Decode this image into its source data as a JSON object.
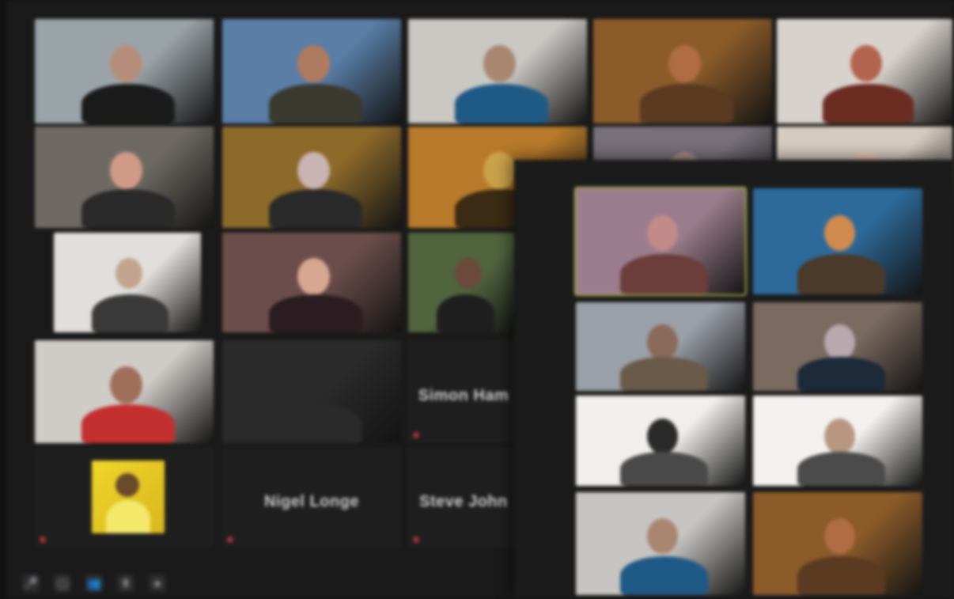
{
  "window": {
    "title": ""
  },
  "back_grid": {
    "tiles": [
      {
        "name": "",
        "bg": "#9aa3a8",
        "skin": "#b48e7a",
        "shirt": "#1b1b1b"
      },
      {
        "name": "",
        "bg": "#5a7ea6",
        "skin": "#b07a5e",
        "shirt": "#3a3a2e"
      },
      {
        "name": "",
        "bg": "#c9c7c2",
        "skin": "#a88670",
        "shirt": "#1f5a86"
      },
      {
        "name": "",
        "bg": "#8b5b2a",
        "skin": "#b06d45",
        "shirt": "#5a3a20"
      },
      {
        "name": "",
        "bg": "#d8d2cc",
        "skin": "#b4644d",
        "shirt": "#6b2c22"
      },
      {
        "name": "",
        "bg": "#6e6a63",
        "skin": "#d09a86",
        "shirt": "#2a2a2a"
      },
      {
        "name": "",
        "bg": "#8c6a2a",
        "skin": "#c9b3b3",
        "shirt": "#2a2a2a"
      },
      {
        "name": "",
        "bg": "#b77a2a",
        "skin": "#caa14a",
        "shirt": "#3b2b14"
      },
      {
        "name": "",
        "bg": "#777079",
        "skin": "#a78f84",
        "shirt": "#3c3c3c"
      },
      {
        "name": "",
        "bg": "#d5cbc0",
        "skin": "#ecc6b4",
        "shirt": "#7b5b4e"
      },
      {
        "name": "",
        "bg": "#e1dedb",
        "skin": "#c2a48e",
        "shirt": "#3a3a3a"
      },
      {
        "name": "",
        "bg": "#6b4e4b",
        "skin": "#d7a691",
        "shirt": "#2a1c20"
      },
      {
        "name": "",
        "bg": "#50643e",
        "skin": "#6a4a3a",
        "shirt": "#1f1f1f"
      },
      {
        "name": "",
        "bg": "#cfcbc6",
        "skin": "#9f6f5c",
        "shirt": "#c3302f"
      },
      {
        "name": "",
        "bg": "#2a2a2a",
        "skin": "#2a2a2a",
        "shirt": "#2a2a2a"
      }
    ],
    "name_only_tiles": [
      {
        "label": "Simon Ham"
      },
      {
        "label": "Nigel Longe"
      },
      {
        "label": "Steve John"
      }
    ],
    "small_avatar_tile": {
      "bg": "#f0d62a",
      "skin": "#6a4a2a"
    }
  },
  "front_grid": {
    "tiles": [
      {
        "bg": "#9a7d8c",
        "skin": "#c28a88",
        "shirt": "#6b3d3b"
      },
      {
        "bg": "#2d6a9a",
        "skin": "#d08a4e",
        "shirt": "#4a3a2a"
      },
      {
        "bg": "#9aa0a8",
        "skin": "#8a6a5a",
        "shirt": "#6a5a4a"
      },
      {
        "bg": "#7a6a60",
        "skin": "#b9a8ad",
        "shirt": "#1c2a3a"
      },
      {
        "bg": "#f0efed",
        "skin": "#2a2a2a",
        "shirt": "#4a4a4a"
      },
      {
        "bg": "#f3f1ef",
        "skin": "#b79680",
        "shirt": "#4b4b4b"
      },
      {
        "bg": "#c6c4c1",
        "skin": "#a88670",
        "shirt": "#1f5a86"
      },
      {
        "bg": "#8b5b2a",
        "skin": "#b06d45",
        "shirt": "#5a3a20"
      }
    ]
  },
  "toolbar": {
    "buttons": [
      {
        "icon": "mic-icon",
        "glyph": "🎤"
      },
      {
        "icon": "video-icon",
        "glyph": "▢"
      },
      {
        "icon": "participants-icon",
        "glyph": "👥"
      },
      {
        "icon": "share-icon",
        "glyph": "⬆"
      },
      {
        "icon": "record-icon",
        "glyph": "●"
      }
    ]
  }
}
